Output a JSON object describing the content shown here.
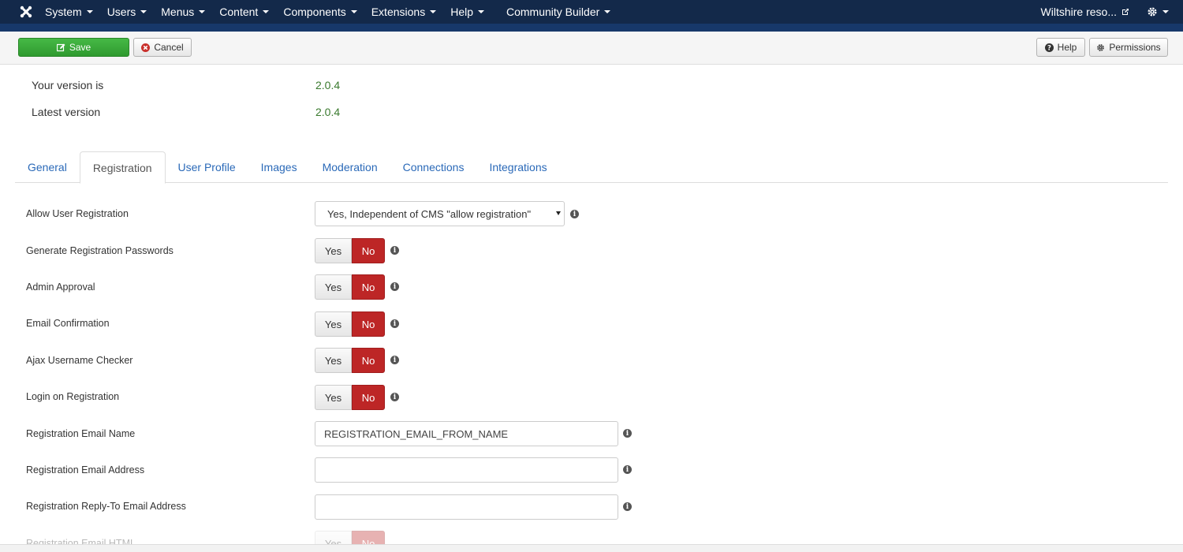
{
  "navbar": {
    "logo_icon": "joomla-logo-icon",
    "menu": [
      "System",
      "Users",
      "Menus",
      "Content",
      "Components",
      "Extensions",
      "Help"
    ],
    "community_builder": "Community Builder",
    "site_name": "Wiltshire reso...",
    "colors": {
      "bar": "#13294a",
      "stripe": "#17386a"
    }
  },
  "toolbar": {
    "save_label": "Save",
    "cancel_label": "Cancel",
    "help_label": "Help",
    "permissions_label": "Permissions",
    "colors": {
      "save": "#3aa83a"
    }
  },
  "version": {
    "your_label": "Your version is",
    "your_value": "2.0.4",
    "latest_label": "Latest version",
    "latest_value": "2.0.4"
  },
  "tabs": [
    "General",
    "Registration",
    "User Profile",
    "Images",
    "Moderation",
    "Connections",
    "Integrations"
  ],
  "active_tab": "Registration",
  "form": {
    "allow_registration": {
      "label": "Allow User Registration",
      "value": "Yes, Independent of CMS \"allow registration\""
    },
    "toggles": [
      {
        "label": "Generate Registration Passwords",
        "yes": "Yes",
        "no": "No",
        "value": "No"
      },
      {
        "label": "Admin Approval",
        "yes": "Yes",
        "no": "No",
        "value": "No"
      },
      {
        "label": "Email Confirmation",
        "yes": "Yes",
        "no": "No",
        "value": "No"
      },
      {
        "label": "Ajax Username Checker",
        "yes": "Yes",
        "no": "No",
        "value": "No"
      },
      {
        "label": "Login on Registration",
        "yes": "Yes",
        "no": "No",
        "value": "No"
      }
    ],
    "email_name": {
      "label": "Registration Email Name",
      "value": "REGISTRATION_EMAIL_FROM_NAME"
    },
    "email_address": {
      "label": "Registration Email Address",
      "value": ""
    },
    "reply_to": {
      "label": "Registration Reply-To Email Address",
      "value": ""
    },
    "email_html": {
      "label": "Registration Email HTML",
      "yes": "Yes",
      "no": "No"
    },
    "colors": {
      "no_active": "#bd2626",
      "link": "#2a69b8"
    }
  }
}
